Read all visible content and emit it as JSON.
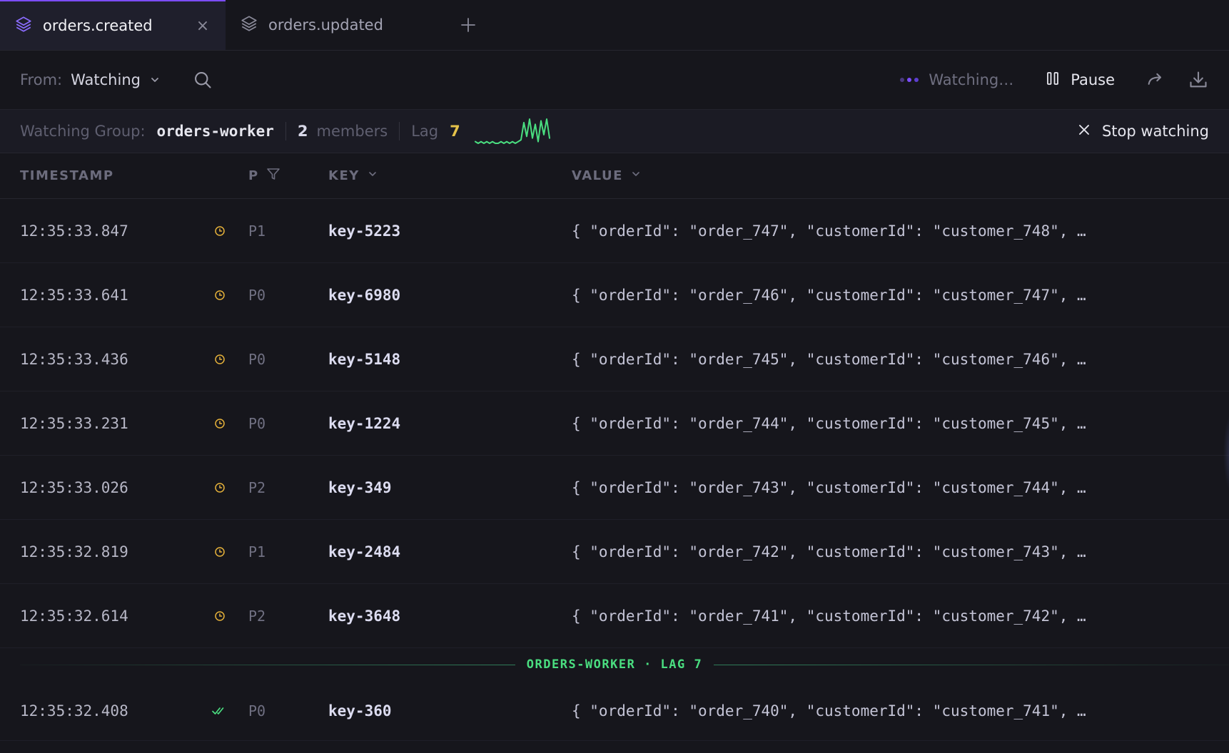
{
  "tabs": [
    {
      "label": "orders.created",
      "active": true,
      "closable": true
    },
    {
      "label": "orders.updated",
      "active": false,
      "closable": false
    }
  ],
  "toolbar": {
    "from_label": "From:",
    "from_value": "Watching",
    "status_text": "Watching…",
    "pause_label": "Pause"
  },
  "watch_bar": {
    "group_label": "Watching Group:",
    "group_name": "orders-worker",
    "members_count": "2",
    "members_label": "members",
    "lag_label": "Lag",
    "lag_value": "7",
    "sparkline": [
      3,
      2,
      3,
      2,
      3,
      2,
      3,
      2,
      2,
      3,
      2,
      3,
      2,
      3,
      2,
      3,
      4,
      14,
      6,
      16,
      5,
      13,
      3,
      15,
      7,
      16,
      5
    ],
    "stop_label": "Stop watching"
  },
  "columns": {
    "timestamp": "TIMESTAMP",
    "partition": "P",
    "key": "KEY",
    "value": "VALUE"
  },
  "rows": [
    {
      "timestamp": "12:35:33.847",
      "status": "pending",
      "partition": "P1",
      "key": "key-5223",
      "value": "{ \"orderId\": \"order_747\", \"customerId\": \"customer_748\", …"
    },
    {
      "timestamp": "12:35:33.641",
      "status": "pending",
      "partition": "P0",
      "key": "key-6980",
      "value": "{ \"orderId\": \"order_746\", \"customerId\": \"customer_747\", …"
    },
    {
      "timestamp": "12:35:33.436",
      "status": "pending",
      "partition": "P0",
      "key": "key-5148",
      "value": "{ \"orderId\": \"order_745\", \"customerId\": \"customer_746\", …"
    },
    {
      "timestamp": "12:35:33.231",
      "status": "pending",
      "partition": "P0",
      "key": "key-1224",
      "value": "{ \"orderId\": \"order_744\", \"customerId\": \"customer_745\", …"
    },
    {
      "timestamp": "12:35:33.026",
      "status": "pending",
      "partition": "P2",
      "key": "key-349",
      "value": "{ \"orderId\": \"order_743\", \"customerId\": \"customer_744\", …"
    },
    {
      "timestamp": "12:35:32.819",
      "status": "pending",
      "partition": "P1",
      "key": "key-2484",
      "value": "{ \"orderId\": \"order_742\", \"customerId\": \"customer_743\", …"
    },
    {
      "timestamp": "12:35:32.614",
      "status": "pending",
      "partition": "P2",
      "key": "key-3648",
      "value": "{ \"orderId\": \"order_741\", \"customerId\": \"customer_742\", …"
    }
  ],
  "divider_label": "ORDERS-WORKER · LAG 7",
  "rows_after": [
    {
      "timestamp": "12:35:32.408",
      "status": "consumed",
      "partition": "P0",
      "key": "key-360",
      "value": "{ \"orderId\": \"order_740\", \"customerId\": \"customer_741\", …"
    }
  ],
  "colors": {
    "accent": "#7c4dff",
    "pending": "#e5b13a",
    "consumed": "#4ade80",
    "lag": "#e5c24a",
    "sparkline": "#4ade80"
  },
  "icons": {
    "tab": "layers-icon",
    "close": "close-icon",
    "add": "plus-icon",
    "search": "search-icon",
    "pause": "pause-icon",
    "share": "share-arrow-icon",
    "download": "download-icon",
    "stop": "close-icon",
    "filter": "filter-icon",
    "sort": "chevron-down-icon",
    "pending": "clock-icon",
    "consumed": "double-check-icon"
  }
}
